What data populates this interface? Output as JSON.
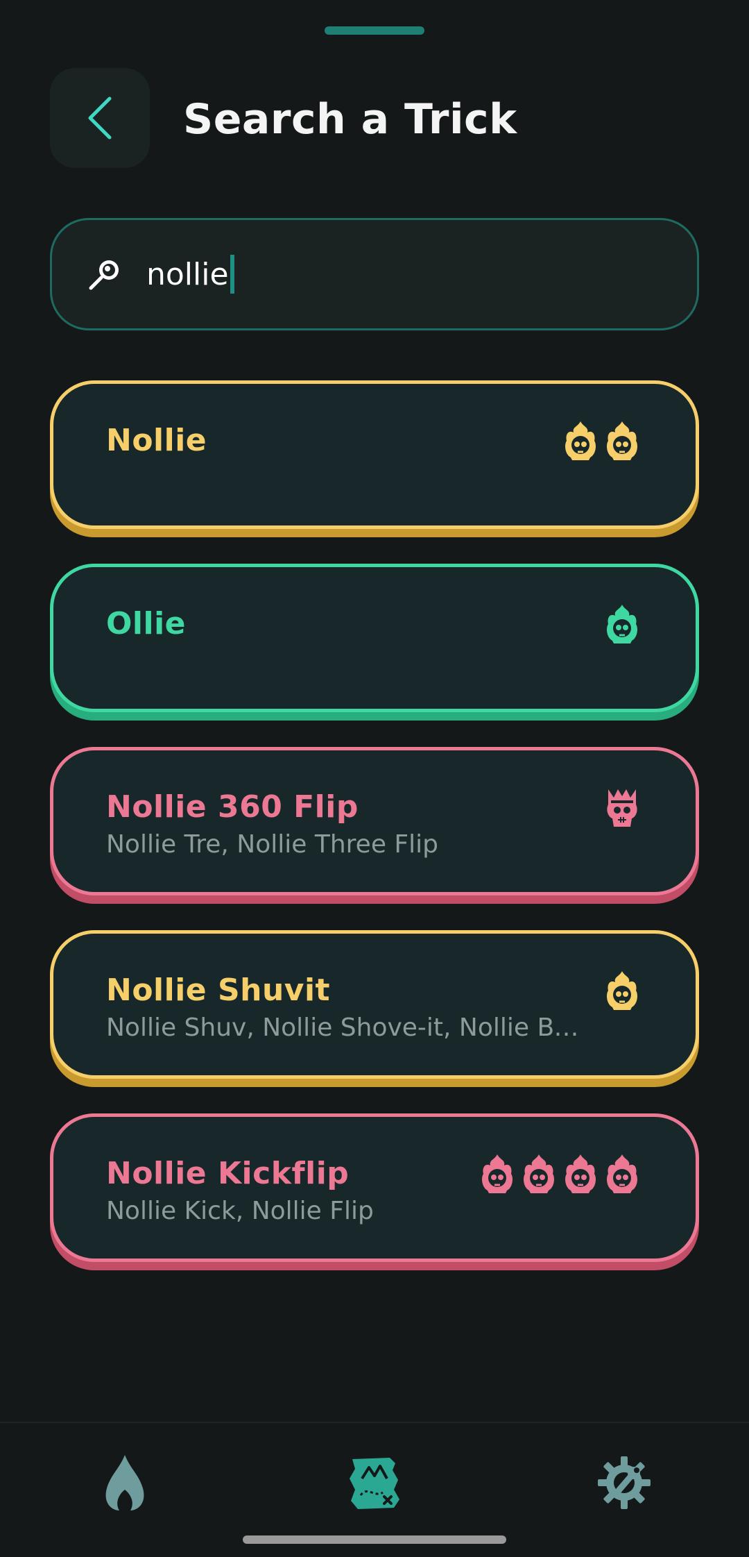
{
  "header": {
    "title": "Search a Trick"
  },
  "search": {
    "value": "nollie"
  },
  "colors": {
    "yellow": "#f6cf6a",
    "yellow_shadow": "#c99a2e",
    "green": "#3fd8a2",
    "green_shadow": "#28ad7f",
    "pink": "#ec7894",
    "pink_shadow": "#c24d66",
    "accent": "#1f8f84"
  },
  "results": [
    {
      "title": "Nollie",
      "subtitle": "",
      "color": "yellow",
      "difficulty_icon": "flaming-skull-icon",
      "difficulty": 2
    },
    {
      "title": "Ollie",
      "subtitle": "",
      "color": "green",
      "difficulty_icon": "flaming-skull-icon",
      "difficulty": 1
    },
    {
      "title": "Nollie 360 Flip",
      "subtitle": "Nollie Tre, Nollie Three Flip",
      "color": "pink",
      "difficulty_icon": "crowned-skull-icon",
      "difficulty": 1
    },
    {
      "title": "Nollie Shuvit",
      "subtitle": "Nollie Shuv, Nollie Shove-it, Nollie BS...",
      "color": "yellow",
      "difficulty_icon": "flaming-skull-icon",
      "difficulty": 1
    },
    {
      "title": "Nollie Kickflip",
      "subtitle": "Nollie Kick, Nollie Flip",
      "color": "pink",
      "difficulty_icon": "flaming-skull-icon",
      "difficulty": 4
    }
  ],
  "nav": [
    {
      "icon": "flame-icon",
      "active": false
    },
    {
      "icon": "map-icon",
      "active": true
    },
    {
      "icon": "settings-icon",
      "active": false
    }
  ]
}
